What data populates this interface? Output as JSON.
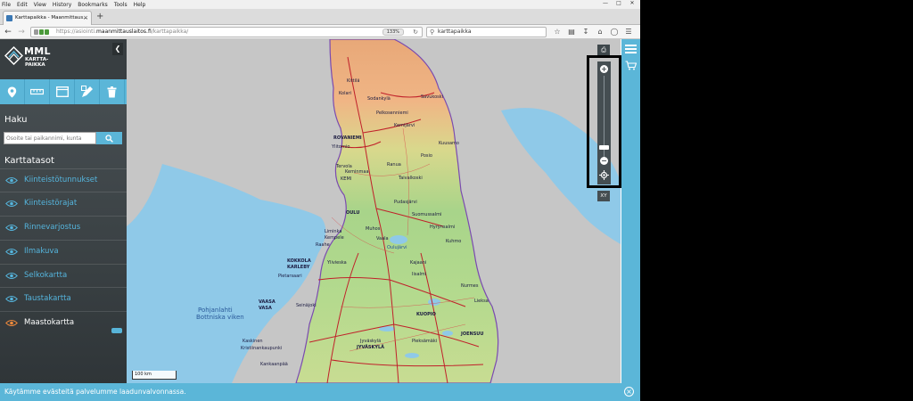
{
  "browser": {
    "menu": [
      "File",
      "Edit",
      "View",
      "History",
      "Bookmarks",
      "Tools",
      "Help"
    ],
    "tab_title": "Karttapaikka - Maanmittaus...",
    "url_prefix": "https://asiointi.",
    "url_host": "maanmittauslaitos.fi",
    "url_path": "/karttapaikka/",
    "zoom": "133%",
    "search_text": "karttapaikka"
  },
  "sidebar": {
    "logo_title": "MML",
    "logo_subtitle": "KARTTA-PAIKKA",
    "search_title": "Haku",
    "search_placeholder": "Osoite tai paikannimi, kunta",
    "layers_title": "Karttatasot",
    "layers": [
      {
        "label": "Kiinteistötunnukset",
        "visible": false
      },
      {
        "label": "Kiinteistörajat",
        "visible": false
      },
      {
        "label": "Rinnevarjostus",
        "visible": false
      },
      {
        "label": "Ilmakuva",
        "visible": false
      },
      {
        "label": "Selkokartta",
        "visible": false
      },
      {
        "label": "Taustakartta",
        "visible": false
      },
      {
        "label": "Maastokartta",
        "visible": true
      }
    ]
  },
  "map": {
    "scale": "100 km",
    "coord_button": "XY",
    "place_labels": [
      "Kittilä",
      "Sodankylä",
      "Savukoski",
      "Kolari",
      "Pelkosenniemi",
      "Kemijärvi",
      "ROVANIEMI",
      "Ylitornio",
      "Tervola",
      "Keminmaa",
      "KEMI",
      "Posio",
      "Kuusamo",
      "Ranua",
      "Taivalkoski",
      "OULU",
      "Liminka",
      "Kempele",
      "Pudasjärvi",
      "Muhos",
      "Kajaani",
      "Kuhmo",
      "Oulujärvi",
      "Suomussalmi",
      "Hyrynsalmi",
      "Raahe",
      "Vaala",
      "KOKKOLA",
      "KARLEBY",
      "Pietarsaari",
      "Ylivieska",
      "Iisalmi",
      "Pieksämäki",
      "VAASA",
      "VASA",
      "Seinäjoki",
      "KUOPIO",
      "JOENSUU",
      "Nurmes",
      "Lieksa",
      "Jyväskylä",
      "JYVÄSKYLÄ",
      "Kristiinankaupunki",
      "Kaskinen",
      "Kankaanpää",
      "Pohjanlahti",
      "Bottniska viken"
    ]
  },
  "notice": {
    "text": "Käytämme evästeitä palvelumme laadunvalvonnassa."
  }
}
